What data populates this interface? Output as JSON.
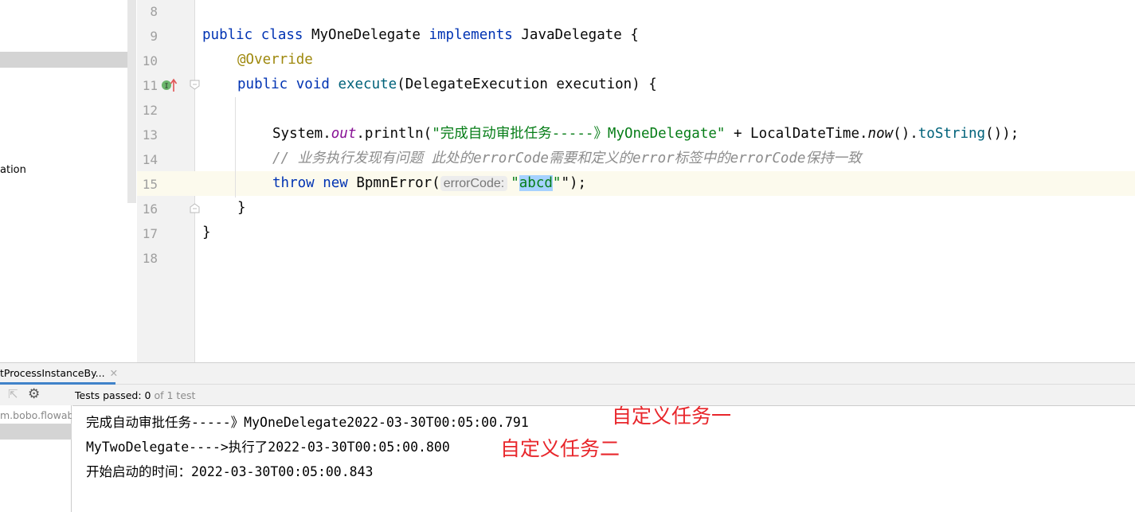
{
  "project_panel": {
    "partial_label": "ation"
  },
  "editor": {
    "line_numbers": [
      "8",
      "9",
      "10",
      "11",
      "12",
      "13",
      "14",
      "15",
      "16",
      "17",
      "18"
    ],
    "lines": {
      "l9": [
        "public",
        " class ",
        "MyOneDelegate",
        " implements ",
        "JavaDelegate {"
      ],
      "l10": "@Override",
      "l11": [
        "public void ",
        "execute",
        "(DelegateExecution execution) {"
      ],
      "l13": [
        "System.",
        "out",
        ".println(",
        "\"完成自动审批任务-----》MyOneDelegate\"",
        " + LocalDateTime.",
        "now",
        "().",
        "toString",
        "());"
      ],
      "l14": "// 业务执行发现有问题 此处的errorCode需要和定义的error标签中的errorCode保持一致",
      "l15": [
        "throw new ",
        "BpmnError(",
        "errorCode:",
        "\"",
        "abcd",
        "\");"
      ],
      "l16": "}",
      "l17": "}"
    }
  },
  "run_panel": {
    "tab_label": "tProcessInstanceBy...",
    "tests_label": "Tests passed:",
    "tests_passed": "0",
    "tests_total": "of 1 test",
    "tree_item": "m.bobo.flowable",
    "console_lines": [
      "完成自动审批任务-----》MyOneDelegate2022-03-30T00:05:00.791",
      "MyTwoDelegate---->执行了2022-03-30T00:05:00.800",
      "开始启动的时间：2022-03-30T00:05:00.843"
    ],
    "annotations": [
      "自定义任务一",
      "自定义任务二"
    ],
    "annotation_color": "#e8262b"
  }
}
